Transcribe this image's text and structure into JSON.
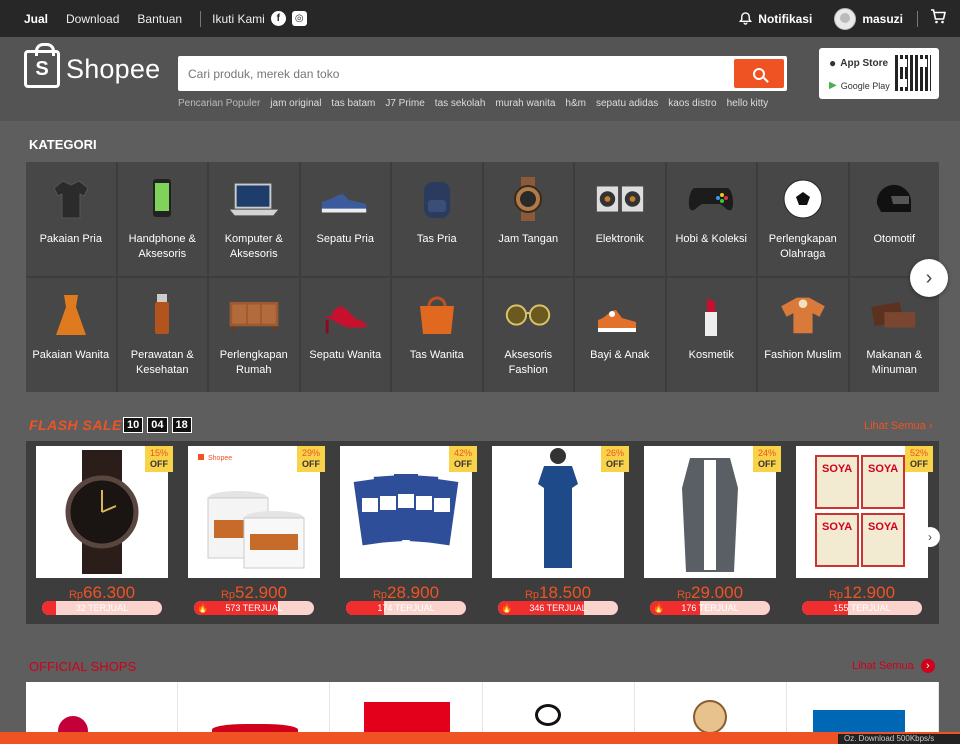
{
  "topbar": {
    "jual": "Jual",
    "download": "Download",
    "bantuan": "Bantuan",
    "ikuti": "Ikuti Kami",
    "facebook_icon": "f",
    "instagram_icon": "◎",
    "notifikasi": "Notifikasi",
    "username": "masuzi"
  },
  "header": {
    "logo_letter": "S",
    "logo_text": "Shopee",
    "search_placeholder": "Cari produk, merek dan toko",
    "popular_label": "Pencarian Populer",
    "popular": [
      "jam original",
      "tas batam",
      "J7 Prime",
      "tas sekolah",
      "murah wanita",
      "h&m",
      "sepatu adidas",
      "kaos distro",
      "hello kitty"
    ],
    "app_store": "App Store",
    "google_play": "Google Play"
  },
  "kategori": {
    "title": "KATEGORI",
    "items": [
      {
        "label": "Pakaian Pria",
        "icon": "shirt-icon"
      },
      {
        "label": "Handphone & Aksesoris",
        "icon": "phone-icon"
      },
      {
        "label": "Komputer & Aksesoris",
        "icon": "laptop-icon"
      },
      {
        "label": "Sepatu Pria",
        "icon": "shoe-icon"
      },
      {
        "label": "Tas Pria",
        "icon": "backpack-icon"
      },
      {
        "label": "Jam Tangan",
        "icon": "watch-icon"
      },
      {
        "label": "Elektronik",
        "icon": "speaker-icon"
      },
      {
        "label": "Hobi & Koleksi",
        "icon": "gamepad-icon"
      },
      {
        "label": "Perlengkapan Olahraga",
        "icon": "ball-icon"
      },
      {
        "label": "Otomotif",
        "icon": "helmet-icon"
      },
      {
        "label": "Pakaian Wanita",
        "icon": "dress-icon"
      },
      {
        "label": "Perawatan & Kesehatan",
        "icon": "bottle-icon"
      },
      {
        "label": "Perlengkapan Rumah",
        "icon": "cabinet-icon"
      },
      {
        "label": "Sepatu Wanita",
        "icon": "heels-icon"
      },
      {
        "label": "Tas Wanita",
        "icon": "handbag-icon"
      },
      {
        "label": "Aksesoris Fashion",
        "icon": "sunglasses-icon"
      },
      {
        "label": "Bayi & Anak",
        "icon": "baby-shoes-icon"
      },
      {
        "label": "Kosmetik",
        "icon": "lipstick-icon"
      },
      {
        "label": "Fashion Muslim",
        "icon": "tunic-icon"
      },
      {
        "label": "Makanan & Minuman",
        "icon": "chocolate-icon"
      }
    ]
  },
  "flash_sale": {
    "title": "FLASH SALE",
    "timer": [
      "10",
      "04",
      "18"
    ],
    "see_all": "Lihat Semua",
    "items": [
      {
        "discount": "15%",
        "off": "OFF",
        "currency": "Rp",
        "price": "66.300",
        "sold": "32 TERJUAL",
        "sold_fraction": 0.12,
        "hot": false
      },
      {
        "discount": "29%",
        "off": "OFF",
        "currency": "Rp",
        "price": "52.900",
        "sold": "573 TERJUAL",
        "sold_fraction": 0.7,
        "hot": true,
        "shop_tag": "Shopee"
      },
      {
        "discount": "42%",
        "off": "OFF",
        "currency": "Rp",
        "price": "28.900",
        "sold": "174 TERJUAL",
        "sold_fraction": 0.32,
        "hot": false
      },
      {
        "discount": "26%",
        "off": "OFF",
        "currency": "Rp",
        "price": "18.500",
        "sold": "346 TERJUAL",
        "sold_fraction": 0.72,
        "hot": true
      },
      {
        "discount": "24%",
        "off": "OFF",
        "currency": "Rp",
        "price": "29.000",
        "sold": "176 TERJUAL",
        "sold_fraction": 0.42,
        "hot": true
      },
      {
        "discount": "52%",
        "off": "OFF",
        "currency": "Rp",
        "price": "12.900",
        "sold": "155 TERJUAL",
        "sold_fraction": 0.38,
        "hot": false
      }
    ]
  },
  "official": {
    "title": "OFFICIAL SHOPS",
    "see_all": "Lihat Semua"
  },
  "taskbar_text": "Oz. Download 500Kbps/s",
  "colors": {
    "brand_orange": "#f05323",
    "official_red": "#d0011b",
    "badge_yellow": "#f8d248"
  }
}
